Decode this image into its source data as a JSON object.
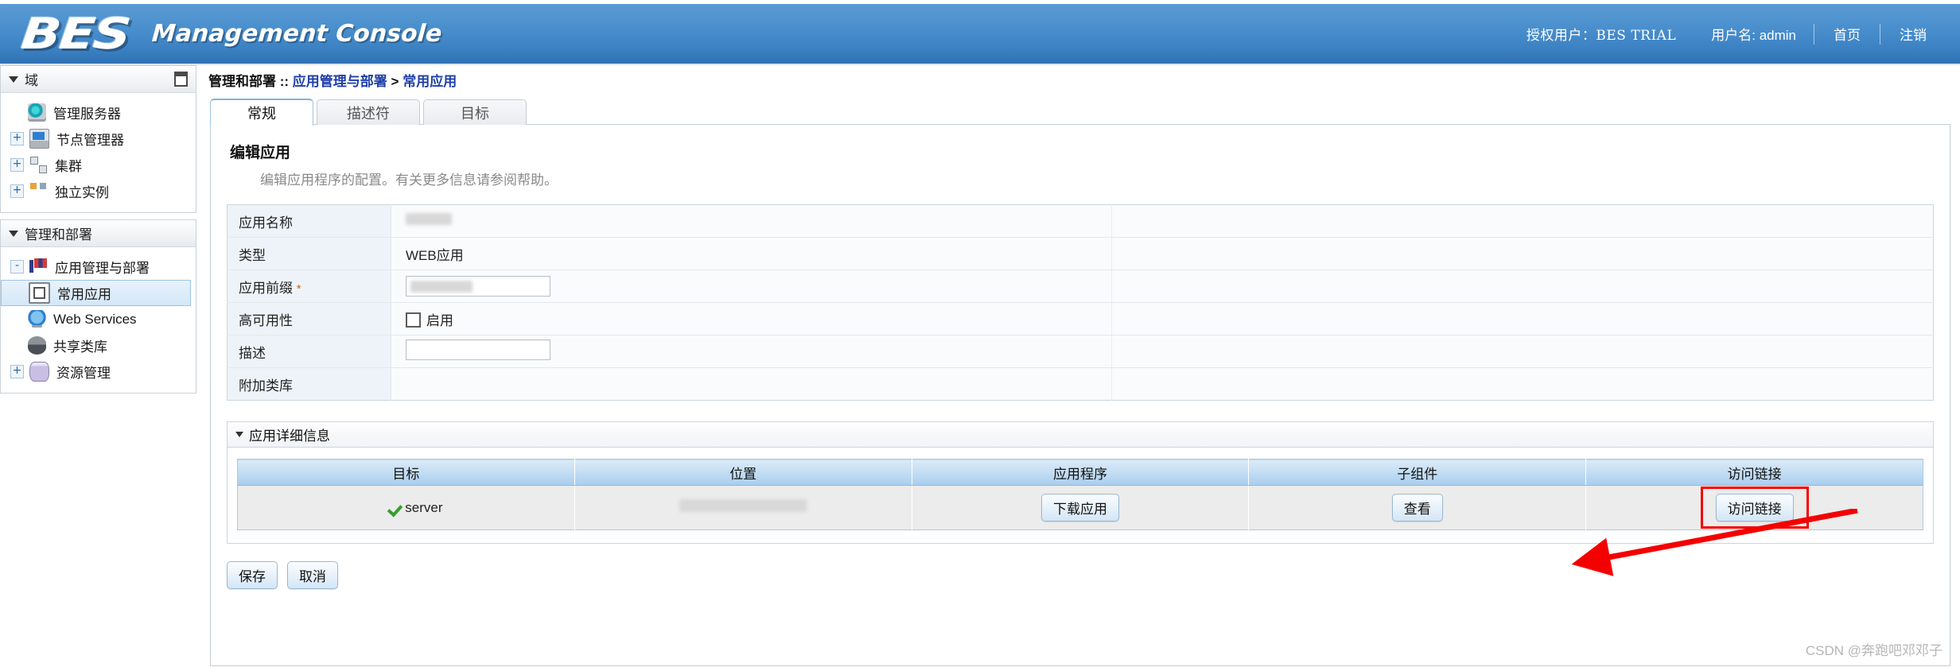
{
  "header": {
    "logo_text": "BES",
    "console_title": "Management Console",
    "license_label": "授权用户：BES TRIAL",
    "user_label": "用户名: admin",
    "home_link": "首页",
    "logout_link": "注销",
    "brand_color": "#3d83c4"
  },
  "sidebar": {
    "panels": [
      {
        "title": "域",
        "items": [
          {
            "label": "管理服务器",
            "expander": "",
            "icon": "server-icon"
          },
          {
            "label": "节点管理器",
            "expander": "+",
            "icon": "node-manager-icon"
          },
          {
            "label": "集群",
            "expander": "+",
            "icon": "cluster-icon"
          },
          {
            "label": "独立实例",
            "expander": "+",
            "icon": "standalone-instance-icon"
          }
        ]
      },
      {
        "title": "管理和部署",
        "items": [
          {
            "label": "应用管理与部署",
            "expander": "-",
            "icon": "app-management-icon"
          },
          {
            "label": "常用应用",
            "expander": "",
            "icon": "application-icon",
            "selected": true
          },
          {
            "label": "Web Services",
            "expander": "",
            "icon": "web-services-icon"
          },
          {
            "label": "共享类库",
            "expander": "",
            "icon": "shared-library-icon"
          },
          {
            "label": "资源管理",
            "expander": "+",
            "icon": "resource-management-icon"
          }
        ]
      }
    ]
  },
  "breadcrumb": {
    "root": "管理和部署",
    "divider": "::",
    "parent": "应用管理与部署",
    "arrow": ">",
    "current": "常用应用"
  },
  "tabs": [
    {
      "label": "常规",
      "active": true
    },
    {
      "label": "描述符",
      "active": false
    },
    {
      "label": "目标",
      "active": false
    }
  ],
  "main": {
    "section_title": "编辑应用",
    "section_desc": "编辑应用程序的配置。有关更多信息请参阅帮助。",
    "form_rows": [
      {
        "label": "应用名称",
        "value": "",
        "kind": "blurred-text",
        "required": false
      },
      {
        "label": "类型",
        "value": "WEB应用",
        "kind": "text",
        "required": false
      },
      {
        "label": "应用前缀",
        "value": "",
        "kind": "blurred-input",
        "required": true
      },
      {
        "label": "高可用性",
        "value": "启用",
        "kind": "checkbox",
        "required": false,
        "checked": false
      },
      {
        "label": "描述",
        "value": "",
        "kind": "input",
        "required": false
      },
      {
        "label": "附加类库",
        "value": "",
        "kind": "empty",
        "required": false
      }
    ]
  },
  "details": {
    "title": "应用详细信息",
    "columns": [
      "目标",
      "位置",
      "应用程序",
      "子组件",
      "访问链接"
    ],
    "rows": [
      {
        "target": "server",
        "target_status_icon": "green-check-icon",
        "location": "",
        "application_button": "下载应用",
        "subcomponent_button": "查看",
        "access_link_button": "访问链接",
        "access_link_highlighted": true
      }
    ]
  },
  "footer": {
    "save_label": "保存",
    "cancel_label": "取消"
  },
  "annotation": {
    "highlight_color": "#f40000",
    "arrow": "pointer-arrow"
  },
  "watermark": "CSDN @奔跑吧邓邓子"
}
